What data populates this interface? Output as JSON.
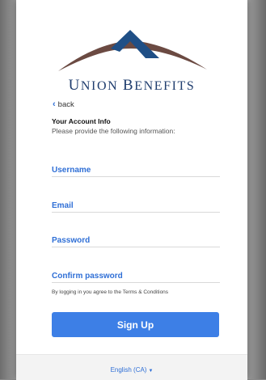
{
  "brand": {
    "name_first_initial": "U",
    "name_first_rest": "NION",
    "name_second_initial": "B",
    "name_second_rest": "ENEFITS",
    "colors": {
      "navy": "#1f3d6e",
      "brown": "#6b4a42",
      "accent": "#3d7fe6"
    }
  },
  "nav": {
    "back_label": "back"
  },
  "form": {
    "heading": "Your Account Info",
    "subheading": "Please provide the following information:",
    "username_label": "Username",
    "email_label": "Email",
    "password_label": "Password",
    "confirm_password_label": "Confirm password",
    "terms_text": "By logging in you agree to the Terms & Conditions",
    "submit_label": "Sign Up"
  },
  "footer": {
    "language_label": "English (CA)",
    "language_icon": "caret-down-icon"
  }
}
